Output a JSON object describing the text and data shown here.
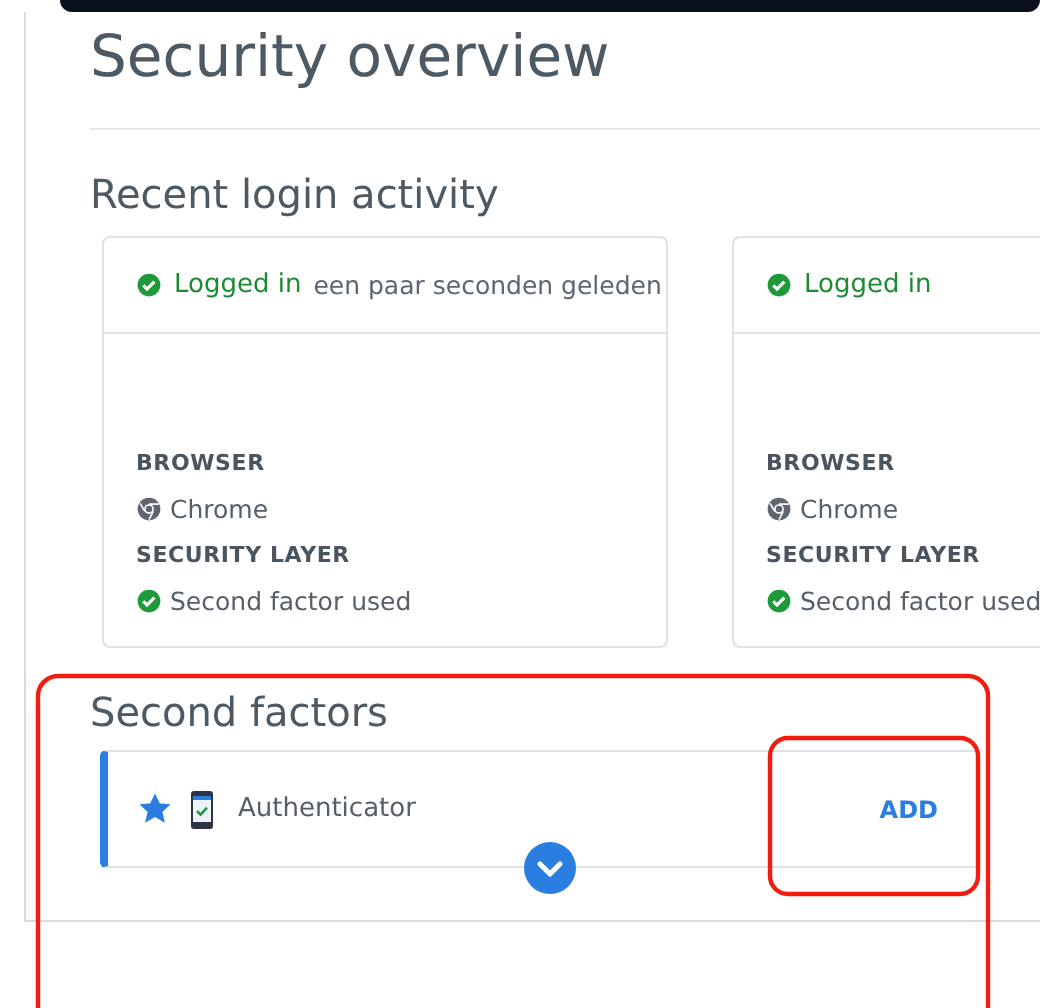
{
  "page": {
    "title": "Security overview"
  },
  "login_activity": {
    "heading": "Recent login activity",
    "sessions": [
      {
        "status": "Logged in",
        "time": "een paar seconden geleden",
        "browser_label": "BROWSER",
        "browser": "Chrome",
        "security_label": "SECURITY LAYER",
        "security": "Second factor used"
      },
      {
        "status": "Logged in",
        "browser_label": "BROWSER",
        "browser": "Chrome",
        "security_label": "SECURITY LAYER",
        "security": "Second factor used"
      }
    ]
  },
  "second_factors": {
    "heading": "Second factors",
    "items": [
      {
        "name": "Authenticator",
        "preferred": true,
        "action": "ADD"
      }
    ]
  }
}
